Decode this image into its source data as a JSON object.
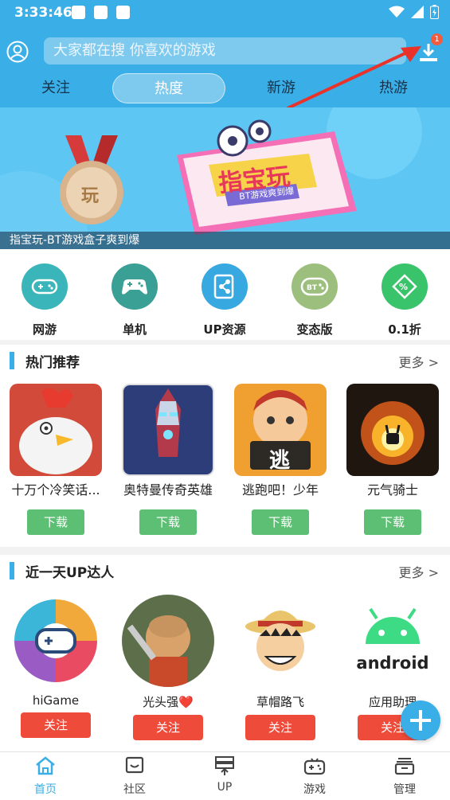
{
  "status_bar": {
    "time": "3:33:46"
  },
  "search": {
    "placeholder": "大家都在搜  你喜欢的游戏",
    "download_badge": "1"
  },
  "tabs": [
    {
      "label": "关注"
    },
    {
      "label": "热度",
      "active": true
    },
    {
      "label": "新游"
    },
    {
      "label": "热游"
    }
  ],
  "banner": {
    "caption": "指宝玩-BT游戏盒子爽到爆",
    "art_title": "指宝玩",
    "art_subtitle": "BT游戏爽到爆",
    "medal_text": "玩"
  },
  "categories": [
    {
      "label": "网游",
      "icon": "gamepad-icon",
      "color": "#3ab5b9"
    },
    {
      "label": "单机",
      "icon": "controller-icon",
      "color": "#3a9f95"
    },
    {
      "label": "UP资源",
      "icon": "share-icon",
      "color": "#38a8e0"
    },
    {
      "label": "变态版",
      "icon": "bt-gamepad-icon",
      "color": "#9cbf7e"
    },
    {
      "label": "0.1折",
      "icon": "discount-tag-icon",
      "color": "#39c36b"
    }
  ],
  "hot": {
    "title": "热门推荐",
    "more": "更多 >",
    "games": [
      {
        "name": "十万个冷笑话...",
        "button": "下载"
      },
      {
        "name": "奥特曼传奇英雄",
        "button": "下载"
      },
      {
        "name": "逃跑吧！少年",
        "button": "下载",
        "sign_text": "逃"
      },
      {
        "name": "元气骑士",
        "button": "下载"
      }
    ]
  },
  "up": {
    "title": "近一天UP达人",
    "more": "更多 >",
    "users": [
      {
        "name": "hiGame",
        "button": "关注"
      },
      {
        "name": "光头强❤️",
        "button": "关注"
      },
      {
        "name": "草帽路飞",
        "button": "关注"
      },
      {
        "name": "应用助理",
        "button": "关注",
        "logo_text": "android"
      }
    ]
  },
  "bottom_nav": [
    {
      "label": "首页",
      "icon": "home-icon",
      "active": true
    },
    {
      "label": "社区",
      "icon": "community-icon"
    },
    {
      "label": "UP",
      "icon": "upload-server-icon"
    },
    {
      "label": "游戏",
      "icon": "gamepad-icon"
    },
    {
      "label": "管理",
      "icon": "manage-icon"
    }
  ],
  "colors": {
    "primary": "#3aaee6",
    "download_green": "#5cbf73",
    "follow_red": "#ef4b3a"
  }
}
